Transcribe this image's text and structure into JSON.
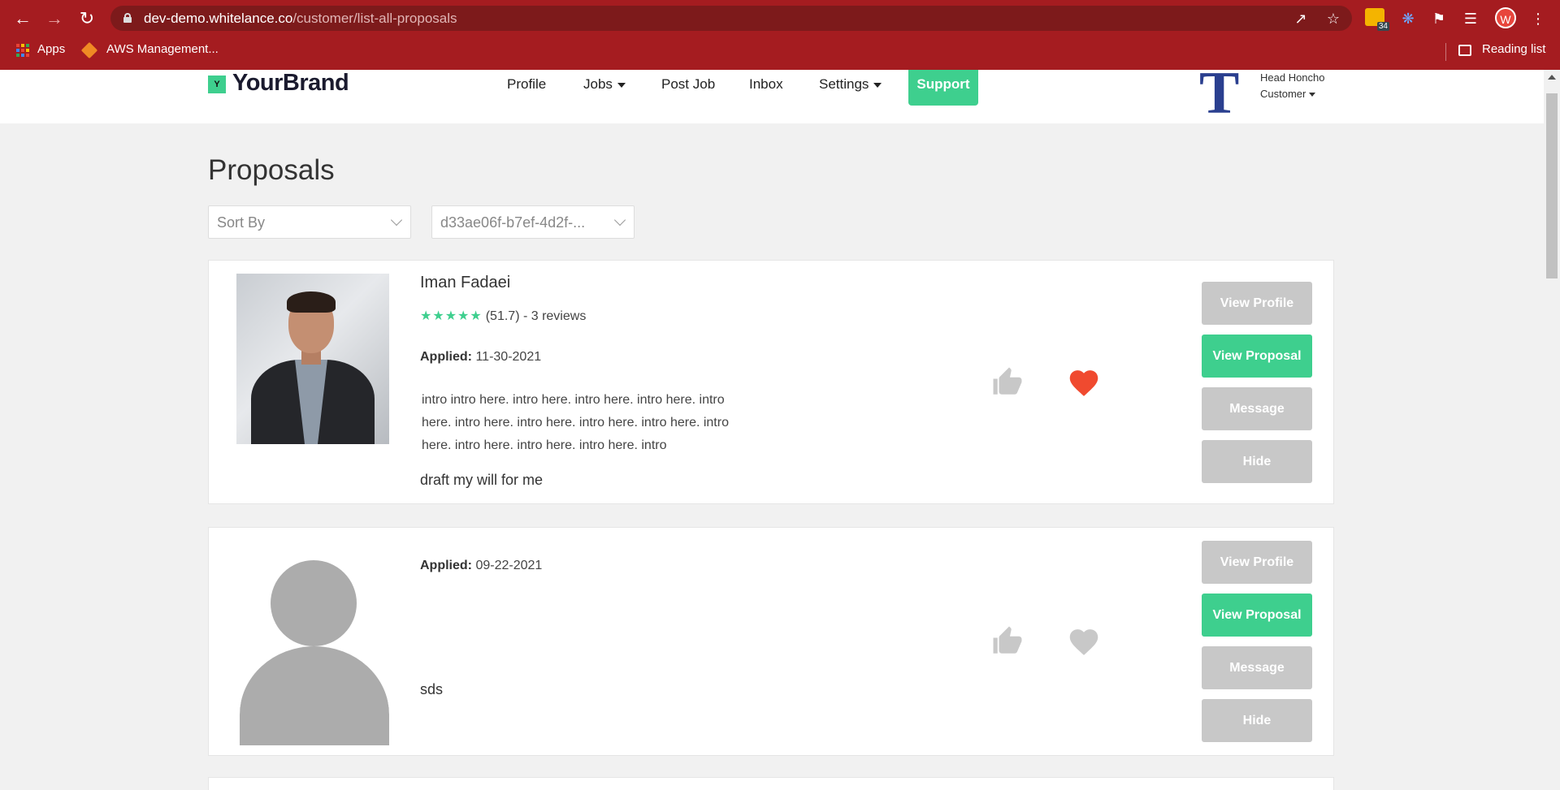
{
  "browser": {
    "url_host": "dev-demo.whitelance.co",
    "url_path": "/customer/list-all-proposals",
    "ext_badge_count": "34",
    "profile_initial": "W",
    "bookmarks": {
      "apps": "Apps",
      "aws": "AWS Management...",
      "reading_list": "Reading list"
    }
  },
  "header": {
    "logo_mark": "Y",
    "logo_text": "YourBrand",
    "nav": {
      "profile": "Profile",
      "jobs": "Jobs",
      "post_job": "Post Job",
      "inbox": "Inbox",
      "settings": "Settings",
      "support": "Support"
    },
    "user": {
      "initial": "T",
      "name": "Head Honcho",
      "role": "Customer"
    }
  },
  "page": {
    "title": "Proposals",
    "sort_select": "Sort By",
    "job_select": "d33ae06f-b7ef-4d2f-..."
  },
  "proposals": [
    {
      "name": "Iman Fadaei",
      "stars": "★★★★★",
      "rating": "(51.7) - 3 reviews",
      "applied_label": "Applied:",
      "applied_date": "11-30-2021",
      "intro": "intro  intro here. intro here. intro here. intro here. intro here. intro here. intro here. intro here. intro here. intro here. intro here. intro here. intro here. intro",
      "project": "draft my will for me",
      "liked": false,
      "favorited": true,
      "buttons": {
        "view_profile": "View Profile",
        "view_proposal": "View Proposal",
        "message": "Message",
        "hide": "Hide"
      }
    },
    {
      "name": "",
      "applied_label": "Applied:",
      "applied_date": "09-22-2021",
      "project": "sds",
      "liked": false,
      "favorited": false,
      "buttons": {
        "view_profile": "View Profile",
        "view_proposal": "View Proposal",
        "message": "Message",
        "hide": "Hide"
      }
    }
  ],
  "colors": {
    "browser_bar": "#a51c20",
    "accent_green": "#3ecf8e",
    "heart_active": "#f04a2f",
    "inactive_gray": "#c8c8c8"
  }
}
